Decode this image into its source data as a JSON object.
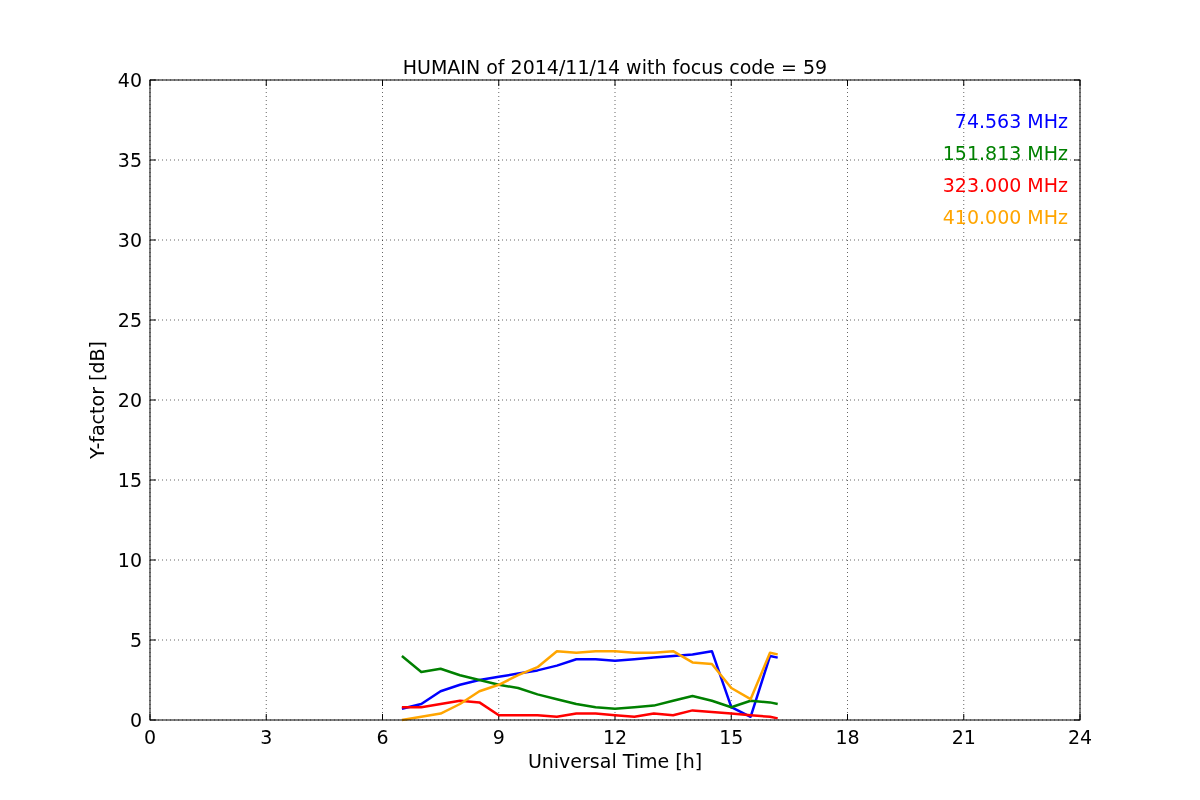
{
  "chart": {
    "chart_data": {
      "type": "line",
      "title": "HUMAIN of 2014/11/14 with focus code = 59",
      "xlabel": "Universal Time [h]",
      "ylabel": "Y-factor [dB]",
      "x": [
        6.5,
        7,
        7.5,
        8,
        8.5,
        9,
        9.5,
        10,
        10.5,
        11,
        11.5,
        12,
        12.5,
        13,
        13.5,
        14,
        14.5,
        15,
        15.5,
        16,
        16.2
      ],
      "series": [
        {
          "name": "74.563 MHz",
          "color": "#0000ff",
          "values": [
            0.7,
            1.0,
            1.8,
            2.2,
            2.5,
            2.7,
            2.9,
            3.1,
            3.4,
            3.8,
            3.8,
            3.7,
            3.8,
            3.9,
            4.0,
            4.1,
            4.3,
            0.8,
            0.2,
            4.0,
            3.9
          ]
        },
        {
          "name": "151.813 MHz",
          "color": "#008000",
          "values": [
            4.0,
            3.0,
            3.2,
            2.8,
            2.5,
            2.2,
            2.0,
            1.6,
            1.3,
            1.0,
            0.8,
            0.7,
            0.8,
            0.9,
            1.2,
            1.5,
            1.2,
            0.8,
            1.2,
            1.1,
            1.0
          ]
        },
        {
          "name": "323.000 MHz",
          "color": "#ff0000",
          "values": [
            0.8,
            0.8,
            1.0,
            1.2,
            1.1,
            0.3,
            0.3,
            0.3,
            0.2,
            0.4,
            0.4,
            0.3,
            0.2,
            0.4,
            0.3,
            0.6,
            0.5,
            0.4,
            0.3,
            0.2,
            0.1
          ]
        },
        {
          "name": "410.000 MHz",
          "color": "#ffa500",
          "values": [
            0.0,
            0.2,
            0.4,
            1.0,
            1.8,
            2.2,
            2.8,
            3.3,
            4.3,
            4.2,
            4.3,
            4.3,
            4.2,
            4.2,
            4.3,
            3.6,
            3.5,
            2.0,
            1.3,
            4.2,
            4.1
          ]
        }
      ],
      "grid": true,
      "xlim": [
        0,
        24
      ],
      "ylim": [
        0,
        40
      ],
      "xticks": [
        0,
        3,
        6,
        9,
        12,
        15,
        18,
        21,
        24
      ],
      "yticks": [
        0,
        5,
        10,
        15,
        20,
        25,
        30,
        35,
        40
      ]
    }
  }
}
